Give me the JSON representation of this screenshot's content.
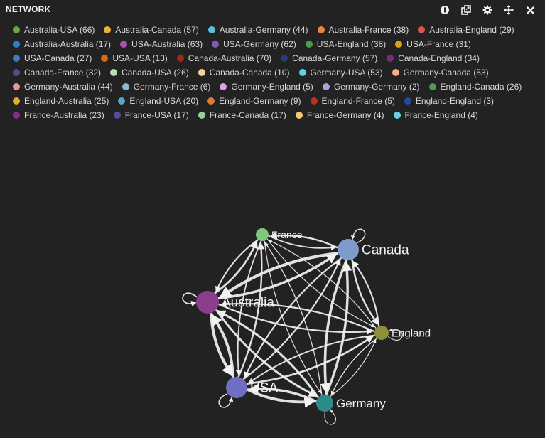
{
  "panel": {
    "title": "NETWORK"
  },
  "toolbar": [
    {
      "name": "info-icon"
    },
    {
      "name": "copy-icon"
    },
    {
      "name": "gear-icon"
    },
    {
      "name": "move-icon"
    },
    {
      "name": "close-icon"
    }
  ],
  "chart_data": {
    "type": "network",
    "nodes": [
      {
        "name": "France",
        "color": "#7fc97f",
        "size": 9,
        "label_size": 14
      },
      {
        "name": "Canada",
        "color": "#7e9cc9",
        "size": 15,
        "label_size": 19
      },
      {
        "name": "Australia",
        "color": "#8c3d8c",
        "size": 16,
        "label_size": 19
      },
      {
        "name": "England",
        "color": "#8f8f3a",
        "size": 10,
        "label_size": 15
      },
      {
        "name": "USA",
        "color": "#6e6ec4",
        "size": 15,
        "label_size": 19
      },
      {
        "name": "Germany",
        "color": "#2f8a8a",
        "size": 12,
        "label_size": 17
      }
    ],
    "links": [
      {
        "source": "Australia",
        "target": "USA",
        "value": 66,
        "label": "Australia-USA (66)",
        "color": "#6aa84f"
      },
      {
        "source": "Australia",
        "target": "Canada",
        "value": 57,
        "label": "Australia-Canada (57)",
        "color": "#e6b33c"
      },
      {
        "source": "Australia",
        "target": "Germany",
        "value": 44,
        "label": "Australia-Germany (44)",
        "color": "#5bc0de"
      },
      {
        "source": "Australia",
        "target": "France",
        "value": 38,
        "label": "Australia-France (38)",
        "color": "#e8834a"
      },
      {
        "source": "Australia",
        "target": "England",
        "value": 29,
        "label": "Australia-England (29)",
        "color": "#d9534f"
      },
      {
        "source": "Australia",
        "target": "Australia",
        "value": 17,
        "label": "Australia-Australia (17)",
        "color": "#2f7fc9"
      },
      {
        "source": "USA",
        "target": "Australia",
        "value": 63,
        "label": "USA-Australia (63)",
        "color": "#b04fb0"
      },
      {
        "source": "USA",
        "target": "Germany",
        "value": 62,
        "label": "USA-Germany (62)",
        "color": "#7a5db0"
      },
      {
        "source": "USA",
        "target": "England",
        "value": 38,
        "label": "USA-England (38)",
        "color": "#4e9a4e"
      },
      {
        "source": "USA",
        "target": "France",
        "value": 31,
        "label": "USA-France (31)",
        "color": "#d4a017"
      },
      {
        "source": "USA",
        "target": "Canada",
        "value": 27,
        "label": "USA-Canada (27)",
        "color": "#3e7cc4"
      },
      {
        "source": "USA",
        "target": "USA",
        "value": 13,
        "label": "USA-USA (13)",
        "color": "#d46a1f"
      },
      {
        "source": "Canada",
        "target": "Australia",
        "value": 70,
        "label": "Canada-Australia (70)",
        "color": "#a3241c"
      },
      {
        "source": "Canada",
        "target": "Germany",
        "value": 57,
        "label": "Canada-Germany (57)",
        "color": "#1f3f7a"
      },
      {
        "source": "Canada",
        "target": "England",
        "value": 34,
        "label": "Canada-England (34)",
        "color": "#7a2a7a"
      },
      {
        "source": "Canada",
        "target": "France",
        "value": 32,
        "label": "Canada-France (32)",
        "color": "#5a4a8a"
      },
      {
        "source": "Canada",
        "target": "USA",
        "value": 26,
        "label": "Canada-USA (26)",
        "color": "#b3dfb3"
      },
      {
        "source": "Canada",
        "target": "Canada",
        "value": 10,
        "label": "Canada-Canada (10)",
        "color": "#f5d29a"
      },
      {
        "source": "Germany",
        "target": "USA",
        "value": 53,
        "label": "Germany-USA (53)",
        "color": "#5dd3e8"
      },
      {
        "source": "Germany",
        "target": "Canada",
        "value": 53,
        "label": "Germany-Canada (53)",
        "color": "#f5b08a"
      },
      {
        "source": "Germany",
        "target": "Australia",
        "value": 44,
        "label": "Germany-Australia (44)",
        "color": "#e89a9a"
      },
      {
        "source": "Germany",
        "target": "France",
        "value": 6,
        "label": "Germany-France (6)",
        "color": "#8ab8d9"
      },
      {
        "source": "Germany",
        "target": "England",
        "value": 5,
        "label": "Germany-England (5)",
        "color": "#d9a3e0"
      },
      {
        "source": "Germany",
        "target": "Germany",
        "value": 2,
        "label": "Germany-Germany (2)",
        "color": "#b0a0d9"
      },
      {
        "source": "England",
        "target": "Canada",
        "value": 26,
        "label": "England-Canada (26)",
        "color": "#4e9a4e"
      },
      {
        "source": "England",
        "target": "Australia",
        "value": 25,
        "label": "England-Australia (25)",
        "color": "#e0b02a"
      },
      {
        "source": "England",
        "target": "USA",
        "value": 20,
        "label": "England-USA (20)",
        "color": "#5aa6c8"
      },
      {
        "source": "England",
        "target": "Germany",
        "value": 9,
        "label": "England-Germany (9)",
        "color": "#e07a3a"
      },
      {
        "source": "England",
        "target": "France",
        "value": 5,
        "label": "England-France (5)",
        "color": "#c0301f"
      },
      {
        "source": "England",
        "target": "England",
        "value": 3,
        "label": "England-England (3)",
        "color": "#1f4f9a"
      },
      {
        "source": "France",
        "target": "Australia",
        "value": 23,
        "label": "France-Australia (23)",
        "color": "#8a2a8a"
      },
      {
        "source": "France",
        "target": "USA",
        "value": 17,
        "label": "France-USA (17)",
        "color": "#5a4a9a"
      },
      {
        "source": "France",
        "target": "Canada",
        "value": 17,
        "label": "France-Canada (17)",
        "color": "#9acb9a"
      },
      {
        "source": "France",
        "target": "Germany",
        "value": 4,
        "label": "France-Germany (4)",
        "color": "#f5c878"
      },
      {
        "source": "France",
        "target": "England",
        "value": 4,
        "label": "France-England (4)",
        "color": "#6ad0e0"
      }
    ],
    "legend_placement": "top"
  }
}
